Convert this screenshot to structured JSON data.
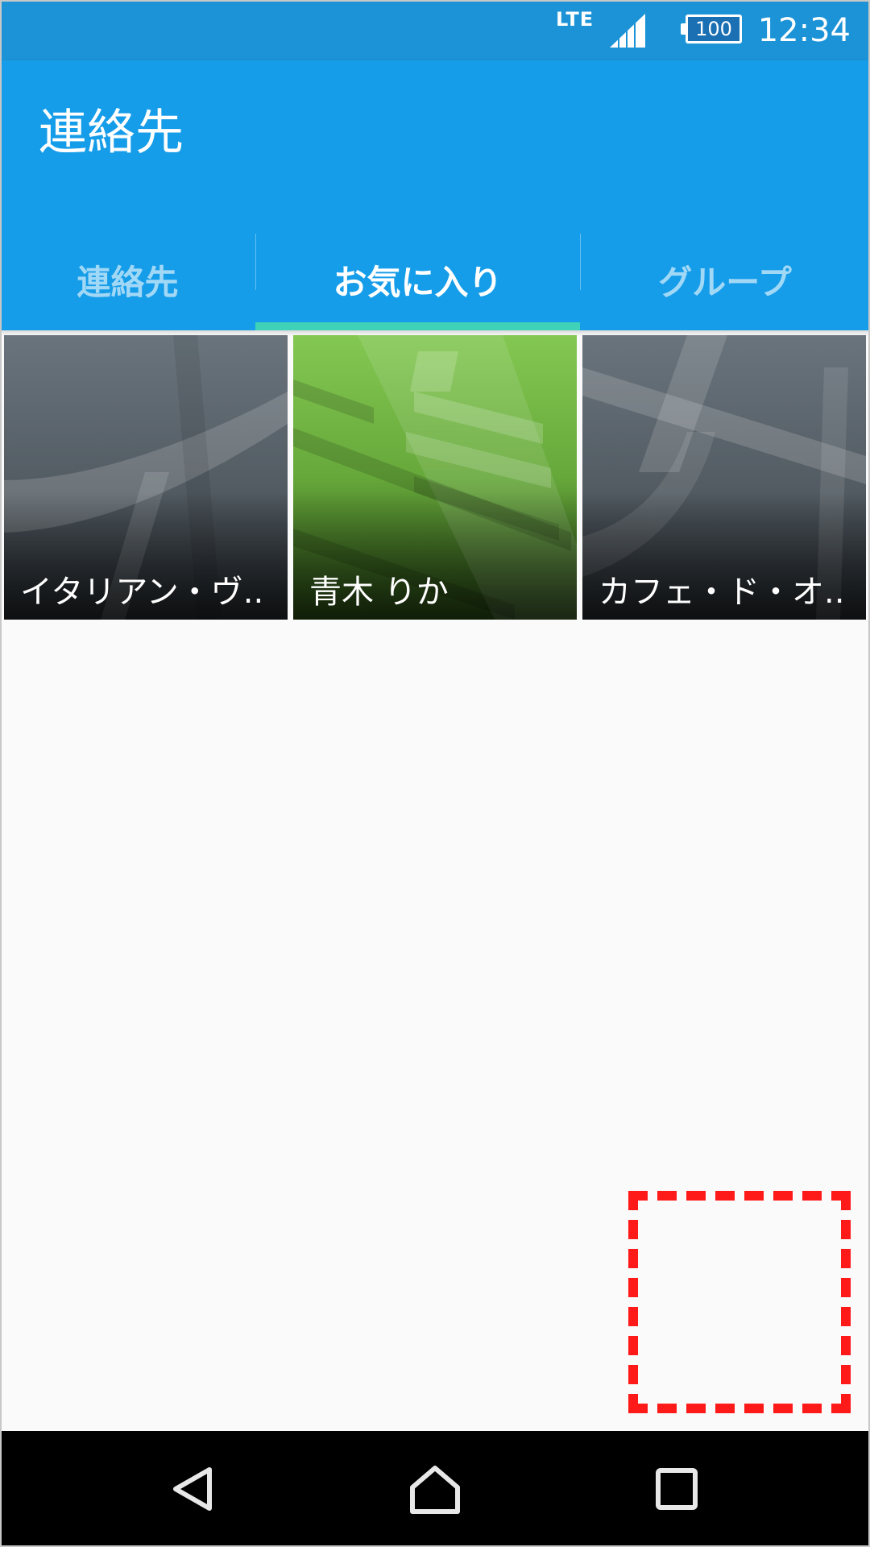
{
  "status_bar": {
    "network": "LTE",
    "battery": "100",
    "time": "12:34",
    "icons": [
      "signal-icon",
      "battery-icon"
    ]
  },
  "app_bar": {
    "title": "連絡先"
  },
  "tabs": [
    {
      "label": "連絡先",
      "active": false
    },
    {
      "label": "お気に入り",
      "active": true
    },
    {
      "label": "グループ",
      "active": false
    }
  ],
  "favorites": [
    {
      "name": "イタリアン・ヴ..",
      "color": "#5a646c"
    },
    {
      "name": "青木 りか",
      "color": "#7cc04a"
    },
    {
      "name": "カフェ・ド・オ..",
      "color": "#5a646c"
    }
  ],
  "nav_bar": {
    "icons": [
      "back-icon",
      "home-icon",
      "recent-apps-icon"
    ]
  },
  "colors": {
    "status_bar": "#1b93d6",
    "app_bar": "#169de9",
    "tab_indicator": "#3fd2b8",
    "highlight_box": "#ff1a1a"
  }
}
